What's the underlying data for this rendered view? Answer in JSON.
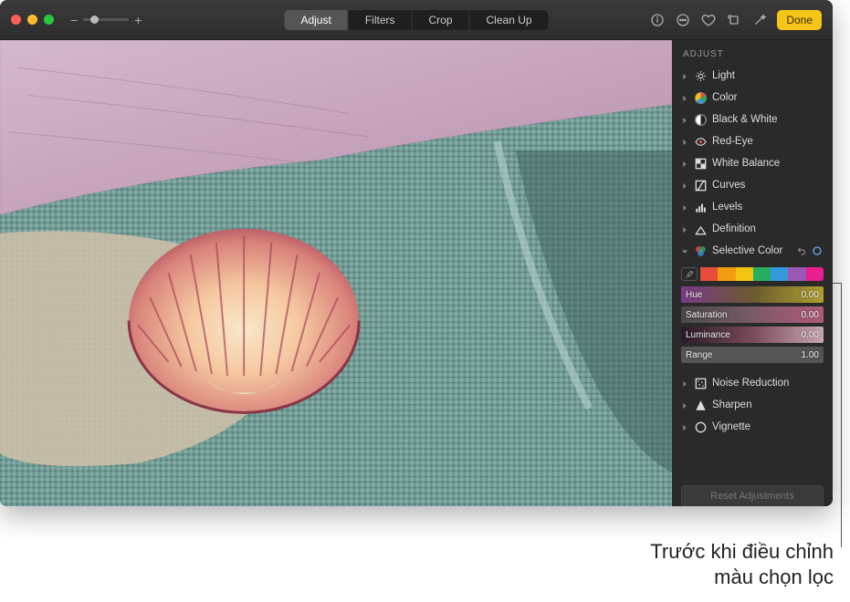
{
  "toolbar": {
    "tabs": [
      "Adjust",
      "Filters",
      "Crop",
      "Clean Up"
    ],
    "done": "Done"
  },
  "sidebar": {
    "header": "ADJUST",
    "items": [
      {
        "label": "Light",
        "icon": "sun"
      },
      {
        "label": "Color",
        "icon": "colorwheel"
      },
      {
        "label": "Black & White",
        "icon": "bw"
      },
      {
        "label": "Red-Eye",
        "icon": "eye"
      },
      {
        "label": "White Balance",
        "icon": "wb"
      },
      {
        "label": "Curves",
        "icon": "curves"
      },
      {
        "label": "Levels",
        "icon": "levels"
      },
      {
        "label": "Definition",
        "icon": "definition"
      },
      {
        "label": "Selective Color",
        "icon": "selcolor"
      },
      {
        "label": "Noise Reduction",
        "icon": "noise"
      },
      {
        "label": "Sharpen",
        "icon": "sharpen"
      },
      {
        "label": "Vignette",
        "icon": "vignette"
      }
    ],
    "selectiveColor": {
      "swatches": [
        "#e74c3c",
        "#f39c12",
        "#f1c40f",
        "#27ae60",
        "#3498db",
        "#9b59b6",
        "#e91e8f"
      ],
      "sliders": [
        {
          "label": "Hue",
          "value": "0.00",
          "grad": "linear-gradient(90deg,#7a3a8a,#6a5a30,#b0a030)"
        },
        {
          "label": "Saturation",
          "value": "0.00",
          "grad": "linear-gradient(90deg,#4a4a4a,#7a5a6a,#b05a7a)"
        },
        {
          "label": "Luminance",
          "value": "0.00",
          "grad": "linear-gradient(90deg,#2a1a28,#7a4a5a,#c8a8b0)"
        },
        {
          "label": "Range",
          "value": "1.00",
          "grad": "#555"
        }
      ]
    },
    "reset": "Reset Adjustments"
  },
  "callout": {
    "l1": "Trước khi điều chỉnh",
    "l2": "màu chọn lọc"
  }
}
